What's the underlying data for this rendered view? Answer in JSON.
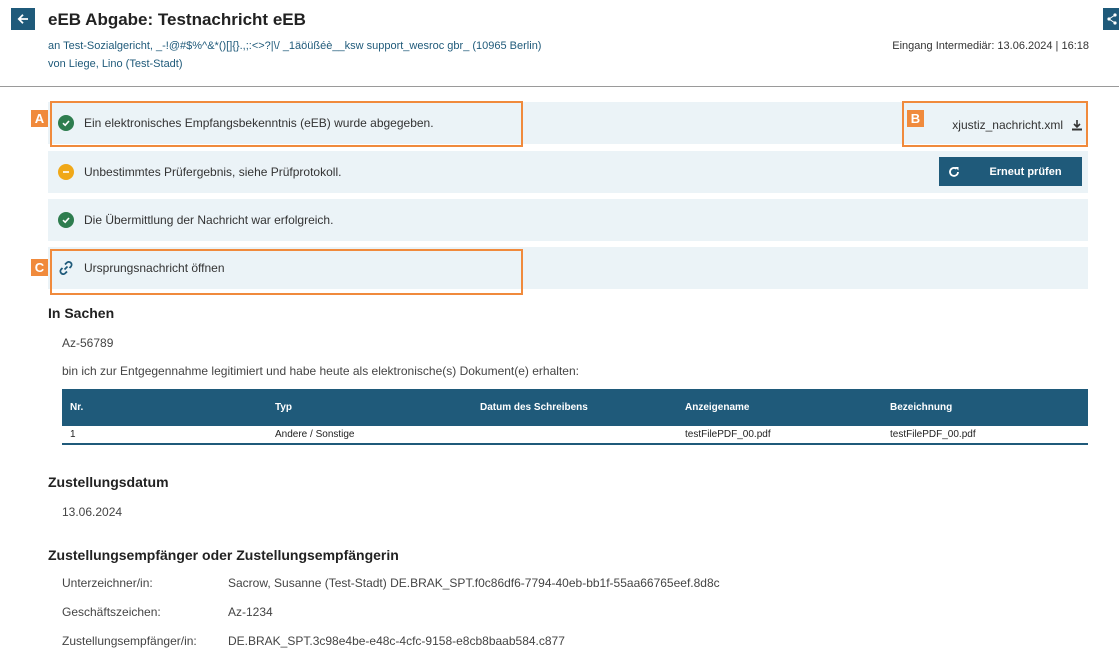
{
  "header": {
    "title": "eEB Abgabe: Testnachricht eEB",
    "to_line": "an Test-Sozialgericht, _-!@#$%^&*()[]{}.,;:<>?|\\/ _1äöüßéè__ksw support_wesroc gbr_ (10965 Berlin)",
    "from_line": "von Liege, Lino (Test-Stadt)",
    "eingang": "Eingang Intermediär: 13.06.2024 | 16:18"
  },
  "status": {
    "eeb_text": "Ein elektronisches Empfangsbekenntnis (eEB) wurde abgegeben.",
    "pruef_text": "Unbestimmtes Prüfergebnis, siehe Prüfprotokoll.",
    "uebermittlung_text": "Die Übermittlung der Nachricht war erfolgreich.",
    "origin_link": "Ursprungsnachricht öffnen",
    "download_file": "xjustiz_nachricht.xml",
    "recheck_label": "Erneut prüfen"
  },
  "markers": {
    "a": "A",
    "b": "B",
    "c": "C"
  },
  "in_sachen": {
    "heading": "In Sachen",
    "az": "Az-56789",
    "statement": "bin ich zur Entgegennahme legitimiert und habe heute als elektronische(s) Dokument(e) erhalten:"
  },
  "table": {
    "headers": [
      "Nr.",
      "Typ",
      "Datum des Schreibens",
      "Anzeigename",
      "Bezeichnung"
    ],
    "rows": [
      [
        "1",
        "Andere / Sonstige",
        "",
        "testFilePDF_00.pdf",
        "testFilePDF_00.pdf"
      ]
    ]
  },
  "zustellung": {
    "heading": "Zustellungsdatum",
    "date": "13.06.2024"
  },
  "empfaenger": {
    "heading": "Zustellungsempfänger oder Zustellungsempfängerin",
    "rows": [
      {
        "label": "Unterzeichner/in:",
        "value": "Sacrow, Susanne (Test-Stadt) DE.BRAK_SPT.f0c86df6-7794-40eb-bb1f-55aa66765eef.8d8c"
      },
      {
        "label": "Geschäftszeichen:",
        "value": "Az-1234"
      },
      {
        "label": "Zustellungsempfänger/in:",
        "value": "DE.BRAK_SPT.3c98e4be-e48c-4cfc-9158-e8cb8baab584.c877"
      }
    ]
  },
  "colors": {
    "primary": "#1f5a7a",
    "success": "#2e7d4f",
    "warning": "#f0a818",
    "highlight": "#f08a3c",
    "bar_bg": "#ebf3f7"
  }
}
